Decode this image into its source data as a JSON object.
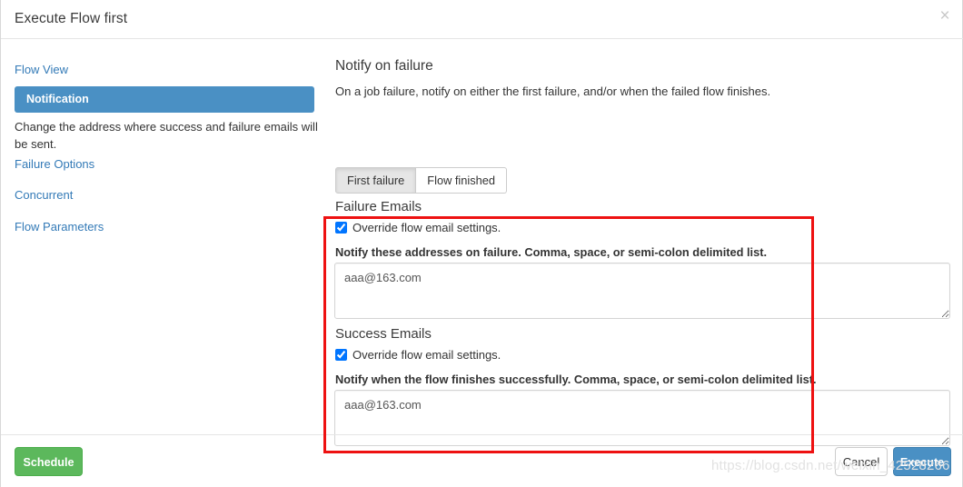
{
  "header": {
    "title": "Execute Flow first",
    "close_label": "×"
  },
  "sidebar": {
    "items": [
      {
        "label": "Flow View",
        "active": false
      },
      {
        "label": "Notification",
        "active": true
      },
      {
        "label": "Failure Options",
        "active": false
      },
      {
        "label": "Concurrent",
        "active": false
      },
      {
        "label": "Flow Parameters",
        "active": false
      }
    ],
    "notification_description": "Change the address where success and failure emails will be sent."
  },
  "main": {
    "section_title": "Notify on failure",
    "section_subtitle": "On a job failure, notify on either the first failure, and/or when the failed flow finishes.",
    "tabs": [
      {
        "label": "First failure",
        "active": true
      },
      {
        "label": "Flow finished",
        "active": false
      }
    ],
    "failure": {
      "heading": "Failure Emails",
      "override_label": "Override flow email settings.",
      "override_checked": true,
      "note": "Notify these addresses on failure. Comma, space, or semi-colon delimited list.",
      "emails_value": "aaa@163.com",
      "emails_placeholder": ""
    },
    "success": {
      "heading": "Success Emails",
      "override_label": "Override flow email settings.",
      "override_checked": true,
      "note": "Notify when the flow finishes successfully. Comma, space, or semi-colon delimited list.",
      "emails_value": "aaa@163.com",
      "emails_placeholder": ""
    }
  },
  "footer": {
    "schedule_label": "Schedule",
    "cancel_label": "Cancel",
    "execute_label": "Execute"
  },
  "watermark": "https://blog.csdn.net/weixin_42528266",
  "colors": {
    "accent_blue": "#4a90c4",
    "success_green": "#5cb85c",
    "link_blue": "#337ab7",
    "annotation_red": "#ee1111"
  }
}
